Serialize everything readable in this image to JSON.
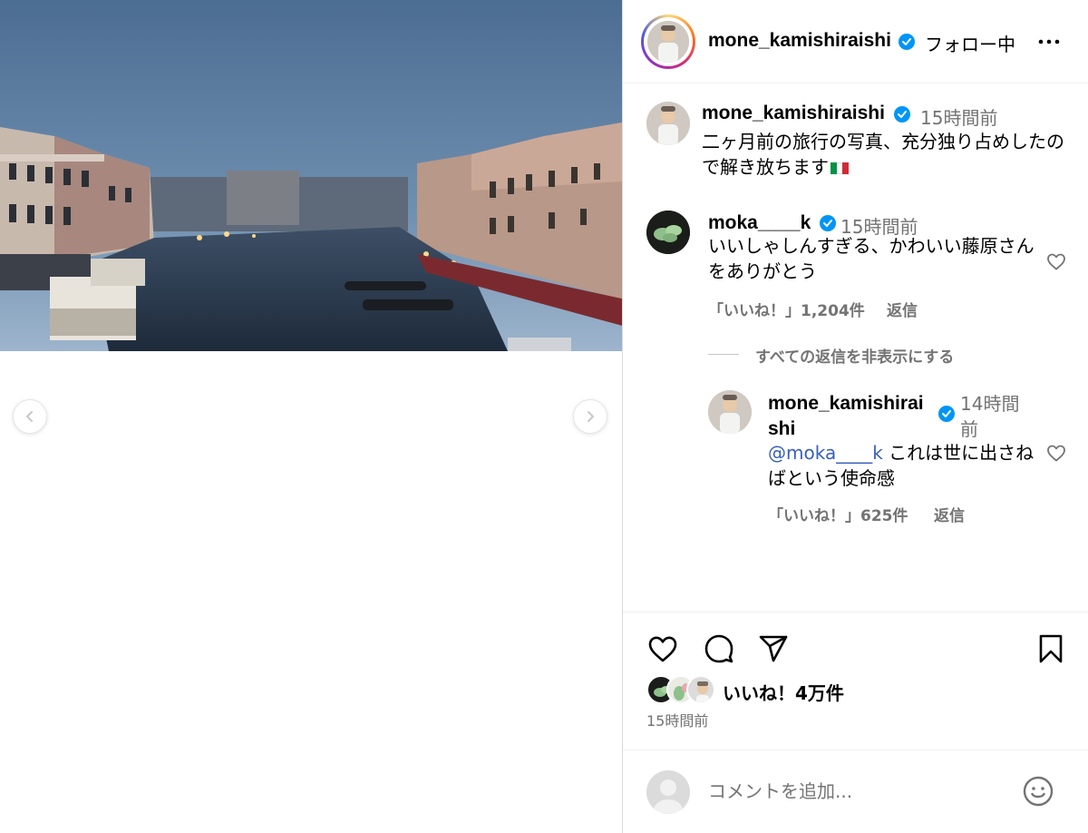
{
  "post": {
    "username": "mone_kamishiraishi",
    "follow_status": "フォロー中",
    "caption_time": "15時間前",
    "caption_text": "二ヶ月前の旅行の写真、充分独り占めしたので解き放ちます",
    "flag": {
      "colors": [
        "#009246",
        "#ffffff",
        "#ce2b37"
      ]
    },
    "likes_text": "いいね！4万件",
    "posted_ago": "15時間前"
  },
  "comments": [
    {
      "username": "moka____k",
      "time": "15時間前",
      "text": "いいしゃしんすぎる、かわいい藤原さんをありがとう",
      "likes": "「いいね！」1,204件",
      "reply_label": "返信"
    }
  ],
  "hide_replies_label": "すべての返信を非表示にする",
  "reply": {
    "username_line1": "mone_kamishirai",
    "username_line2": "shi",
    "time_line1": "14時間",
    "time_line2": "前",
    "mention": "@moka____k",
    "text": " これは世に出さねばという使命感",
    "likes": "「いいね！」625件",
    "reply_label": "返信"
  },
  "comment_input": {
    "placeholder": "コメントを追加..."
  },
  "icons": {
    "carousel_prev": "chevron-left-icon",
    "carousel_next": "chevron-right-icon",
    "more": "more-options-icon",
    "verified": "verified-badge-icon",
    "like": "heart-icon",
    "comment": "comment-bubble-icon",
    "share": "paper-plane-icon",
    "save": "bookmark-icon",
    "emoji": "smiley-icon"
  },
  "colors": {
    "verified": "#0095f6",
    "secondary_text": "#737373",
    "mention": "#385fbd"
  }
}
